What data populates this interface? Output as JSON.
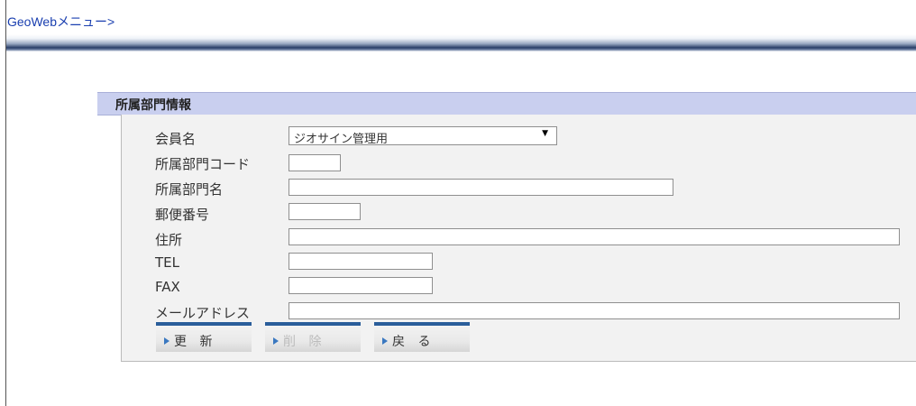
{
  "nav": {
    "menu_link": "GeoWebメニュー>"
  },
  "panel": {
    "title": "所属部門情報"
  },
  "form": {
    "member": {
      "label": "会員名",
      "value": "ジオサイン管理用"
    },
    "dept_code": {
      "label": "所属部門コード",
      "value": ""
    },
    "dept_name": {
      "label": "所属部門名",
      "value": ""
    },
    "postal": {
      "label": "郵便番号",
      "value": ""
    },
    "address": {
      "label": "住所",
      "value": ""
    },
    "tel": {
      "label": "TEL",
      "value": ""
    },
    "fax": {
      "label": "FAX",
      "value": ""
    },
    "email": {
      "label": "メールアドレス",
      "value": ""
    }
  },
  "buttons": {
    "update": "更 新",
    "delete": "削 除",
    "back": "戻 る"
  },
  "icons": {
    "select_arrow": "triangle-down-icon",
    "button_marker": "triangle-right-icon"
  },
  "colors": {
    "header_bg": "#c9cfef",
    "button_accent": "#2a5d9a",
    "link": "#1a3fb0"
  }
}
